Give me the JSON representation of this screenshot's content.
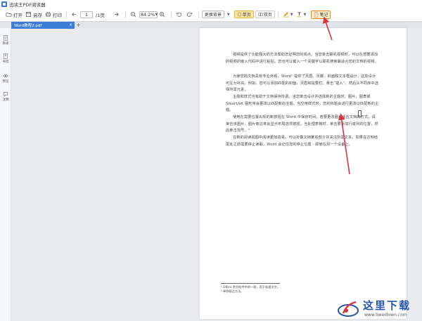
{
  "app": {
    "title": "迅读王PDF阅读器"
  },
  "toolbar": {
    "open_label": "打开",
    "save_label": "另存",
    "print_label": "打印",
    "current_page": "1",
    "total_pages": "/1页",
    "zoom_value": "84.2%",
    "bg_label": "更换背景",
    "single_page_label": "单页",
    "double_page_label": "双页",
    "note_label": "笔记"
  },
  "tabs": {
    "active_label": "Word教程2.pdf",
    "close_glyph": "×",
    "add_glyph": "+"
  },
  "sidebar": {
    "items": [
      {
        "label": "目录"
      },
      {
        "label": "书签"
      },
      {
        "label": "预览"
      },
      {
        "label": "注释"
      }
    ]
  },
  "document": {
    "paragraphs": [
      "视频提供了功能强大的方法帮助您证明您的观点。当您单击联机视频时，可以在想要添加的视频的嵌入代码中进行粘贴。您也可以键入一个关键字以联机搜索最适合您的文档的视频。",
      "为使您的文档具有专业外观，Word¹ 提供了页眉、页脚、封面和文本框设计，这些设计可互为补充。例如，您可以添加匹配的封面、页眉和提要栏。单击“插入”，然后从不同库中选择所需元素。",
      "主题和样式也有助于文档保持协调。当您单击设计并选择新的主题时，图片、图表或 SmartArt 图形将会更改以匹配新的主题。当应用样式时，您的标题会进行更改以匹配新的主题。",
      "使用在需要位置出现的新按钮在 Word 中保存时间。若要更改图片适应文档的方式，请单击该图片，图片旁边将会显示布局选项按钮。当处理表格时，单击要添加行或列的位置，然后单击加号。²",
      "在新的阅读视图中阅读更加容易。可以折叠文档某些部分并关注所需文本。如果在达到结尾处之前需要停止读取，Word 会记住您的停止位置 - 即使在另一个设备上。"
    ],
    "footnotes": [
      "¹ Office 系列软件中的一款，用于处理文字。",
      "² 单例插注方法。"
    ]
  },
  "watermark": {
    "text": "这里下载",
    "url": "www.liweidown.com"
  },
  "colors": {
    "accent": "#3d7dd8",
    "annotation_arrow": "#d9343f",
    "note_button": "#fff3cf"
  }
}
